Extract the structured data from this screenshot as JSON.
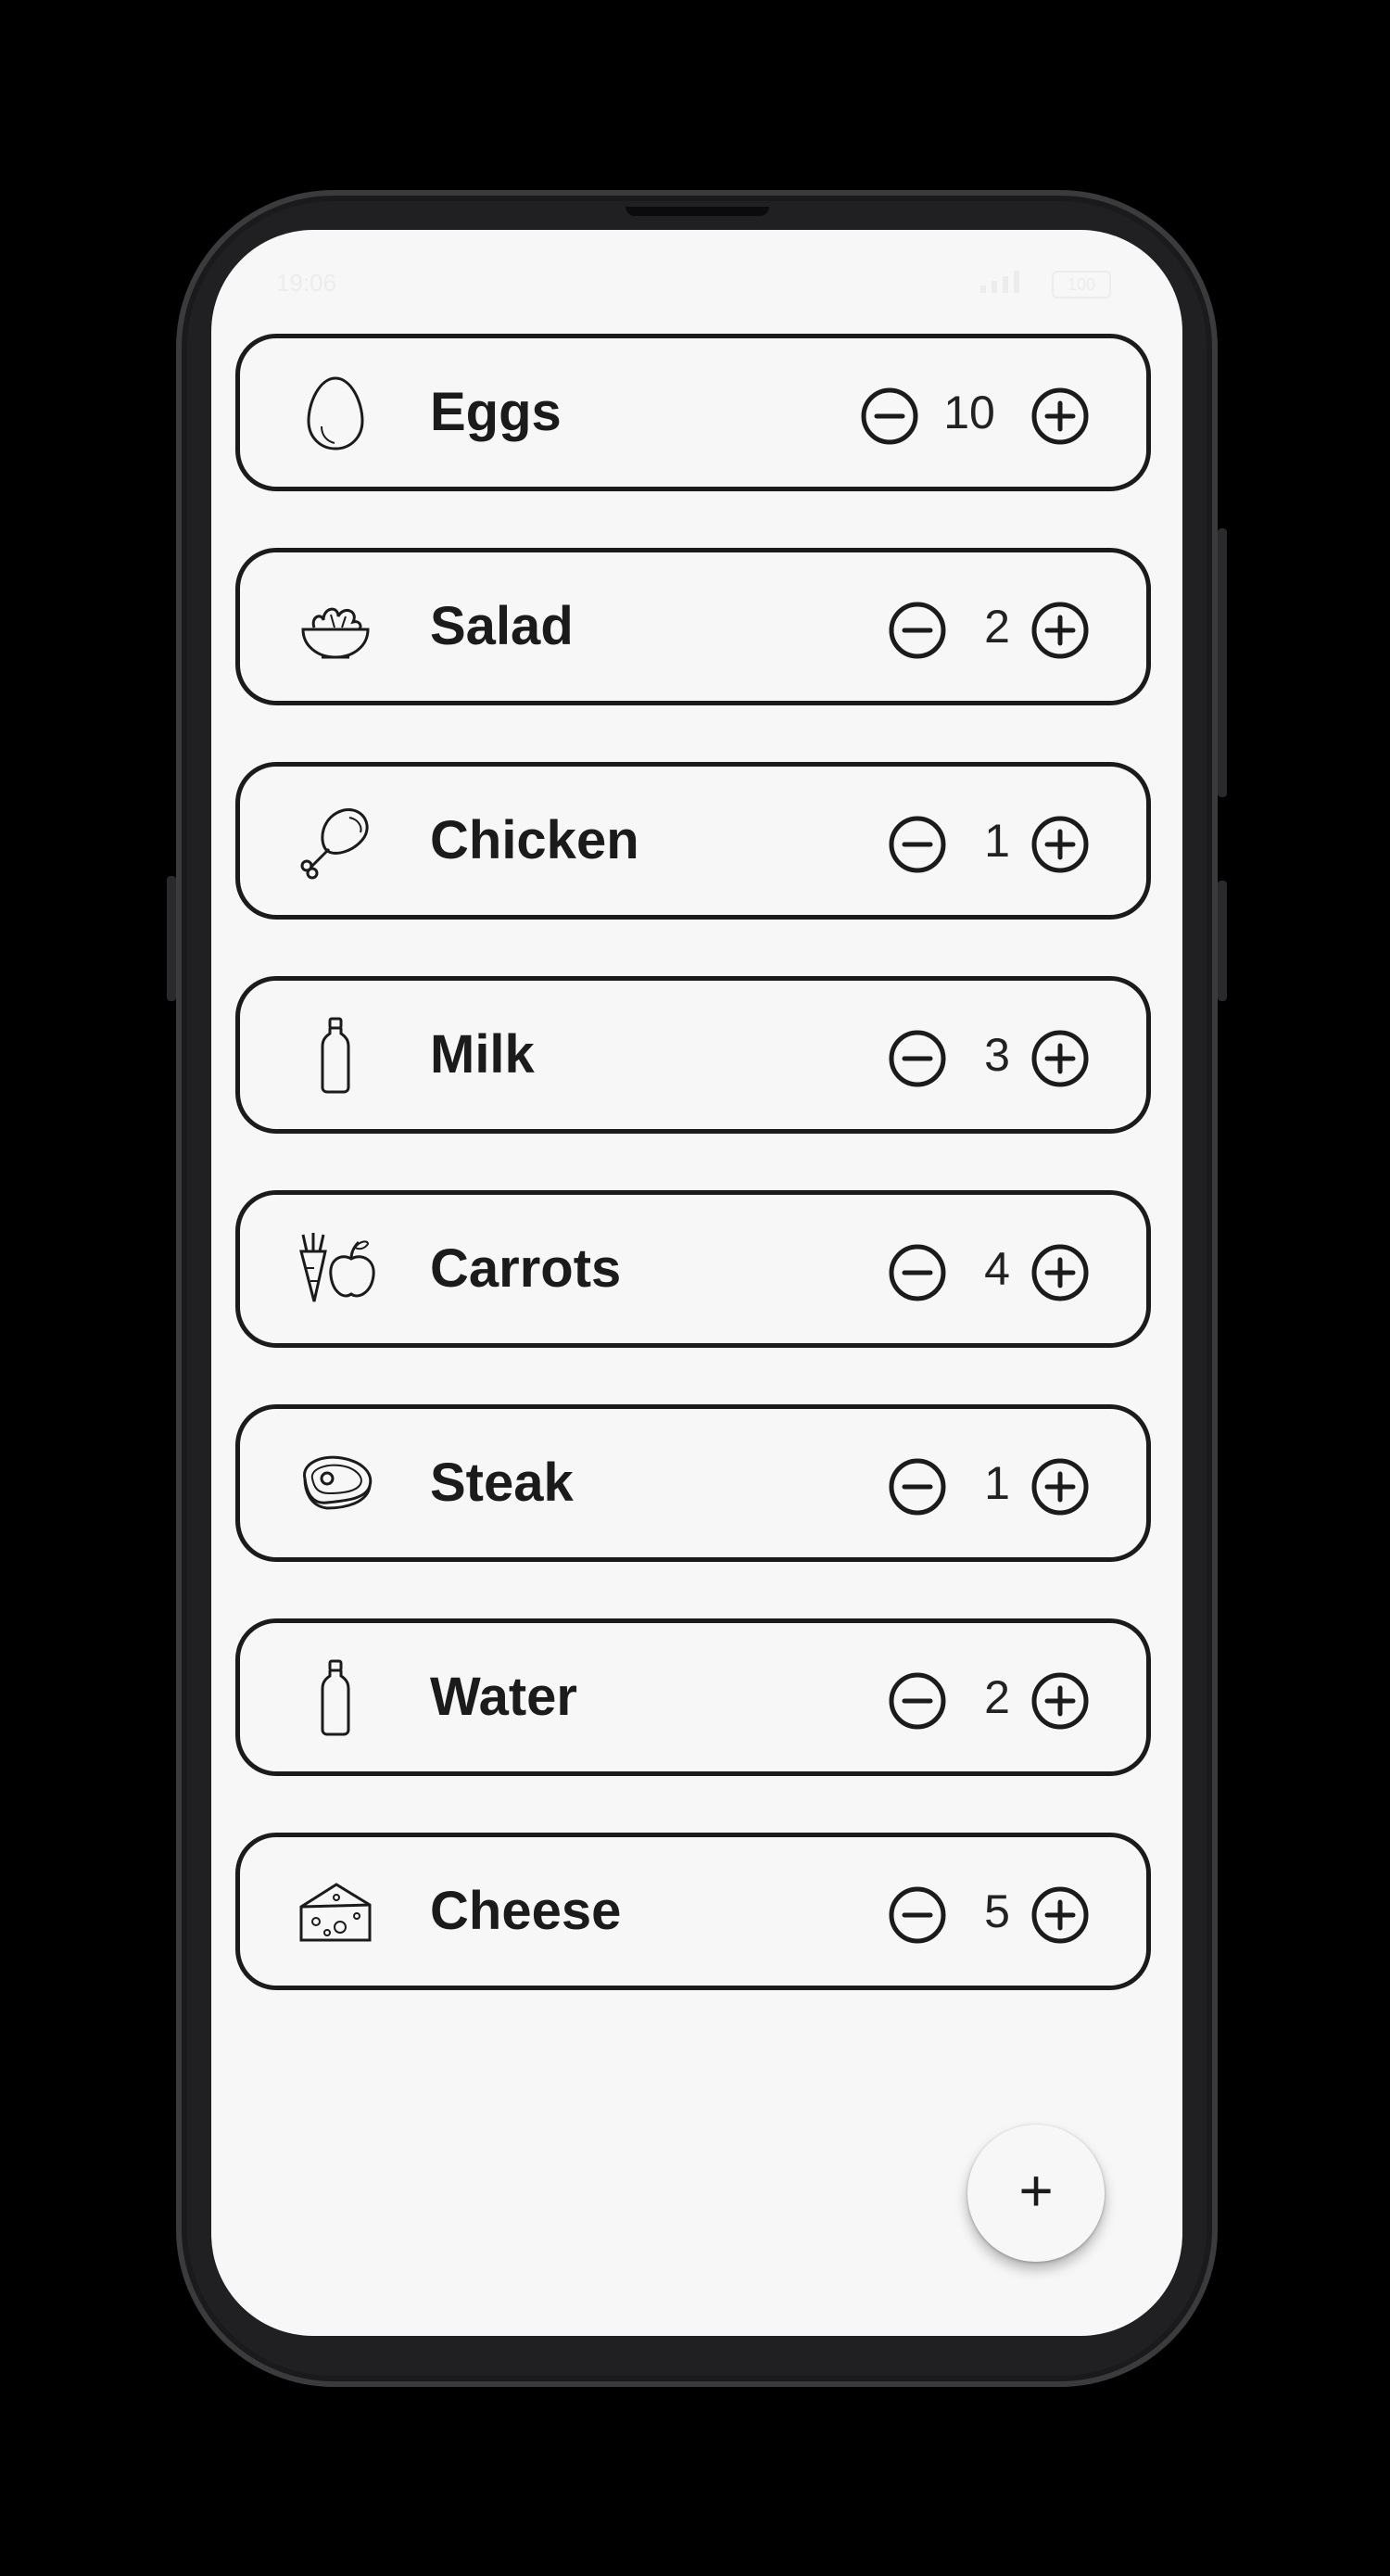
{
  "status_bar": {
    "time": "19:06",
    "battery": "100"
  },
  "items": [
    {
      "name": "Eggs",
      "quantity": "10",
      "icon": "egg-icon"
    },
    {
      "name": "Salad",
      "quantity": "2",
      "icon": "salad-bowl-icon"
    },
    {
      "name": "Chicken",
      "quantity": "1",
      "icon": "chicken-leg-icon"
    },
    {
      "name": "Milk",
      "quantity": "3",
      "icon": "bottle-icon"
    },
    {
      "name": "Carrots",
      "quantity": "4",
      "icon": "carrot-apple-icon"
    },
    {
      "name": "Steak",
      "quantity": "1",
      "icon": "steak-icon"
    },
    {
      "name": "Water",
      "quantity": "2",
      "icon": "bottle-icon"
    },
    {
      "name": "Cheese",
      "quantity": "5",
      "icon": "cheese-icon"
    }
  ],
  "fab": {
    "label": "+",
    "icon": "add-icon"
  },
  "colors": {
    "screen_bg": "#f7f7f7",
    "outline": "#1b1b1b",
    "frame": "#202022"
  }
}
